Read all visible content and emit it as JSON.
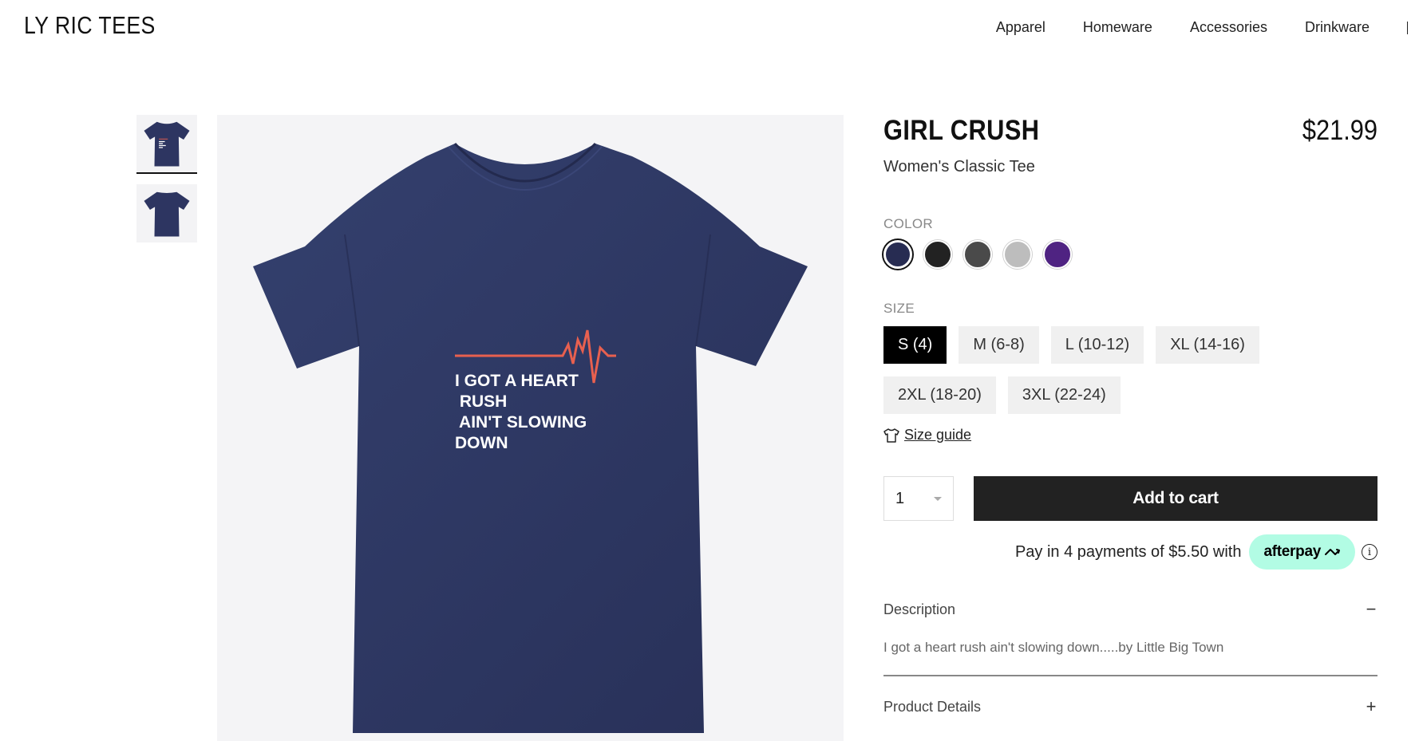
{
  "header": {
    "brand": "LY RIC TEES",
    "nav": [
      "Apparel",
      "Homeware",
      "Accessories",
      "Drinkware"
    ]
  },
  "product": {
    "title": "GIRL CRUSH",
    "price": "$21.99",
    "subtitle": "Women's Classic Tee",
    "shirt_color": "#2d3561",
    "design_text": [
      "I GOT A HEART",
      " RUSH",
      " AIN'T SLOWING",
      "DOWN"
    ],
    "heartbeat_color": "#e8604f"
  },
  "options": {
    "color_label": "COLOR",
    "colors": [
      {
        "hex": "#272c52",
        "selected": true
      },
      {
        "hex": "#222222",
        "selected": false
      },
      {
        "hex": "#4a4a4a",
        "selected": false
      },
      {
        "hex": "#bdbdbd",
        "selected": false
      },
      {
        "hex": "#4f2382",
        "selected": false
      }
    ],
    "size_label": "SIZE",
    "sizes": [
      "S (4)",
      "M (6-8)",
      "L (10-12)",
      "XL (14-16)",
      "2XL (18-20)",
      "3XL (22-24)"
    ],
    "selected_size": "S (4)",
    "size_guide": "Size guide"
  },
  "cart": {
    "quantity": "1",
    "add_to_cart": "Add to cart"
  },
  "afterpay": {
    "text": "Pay in 4 payments of $5.50 with",
    "brand": "afterpay",
    "info": "i"
  },
  "accordion": {
    "description_title": "Description",
    "description_toggle": "−",
    "description_body": "I got a heart rush ain't slowing down.....by Little Big Town",
    "details_title": "Product Details",
    "details_toggle": "+"
  }
}
